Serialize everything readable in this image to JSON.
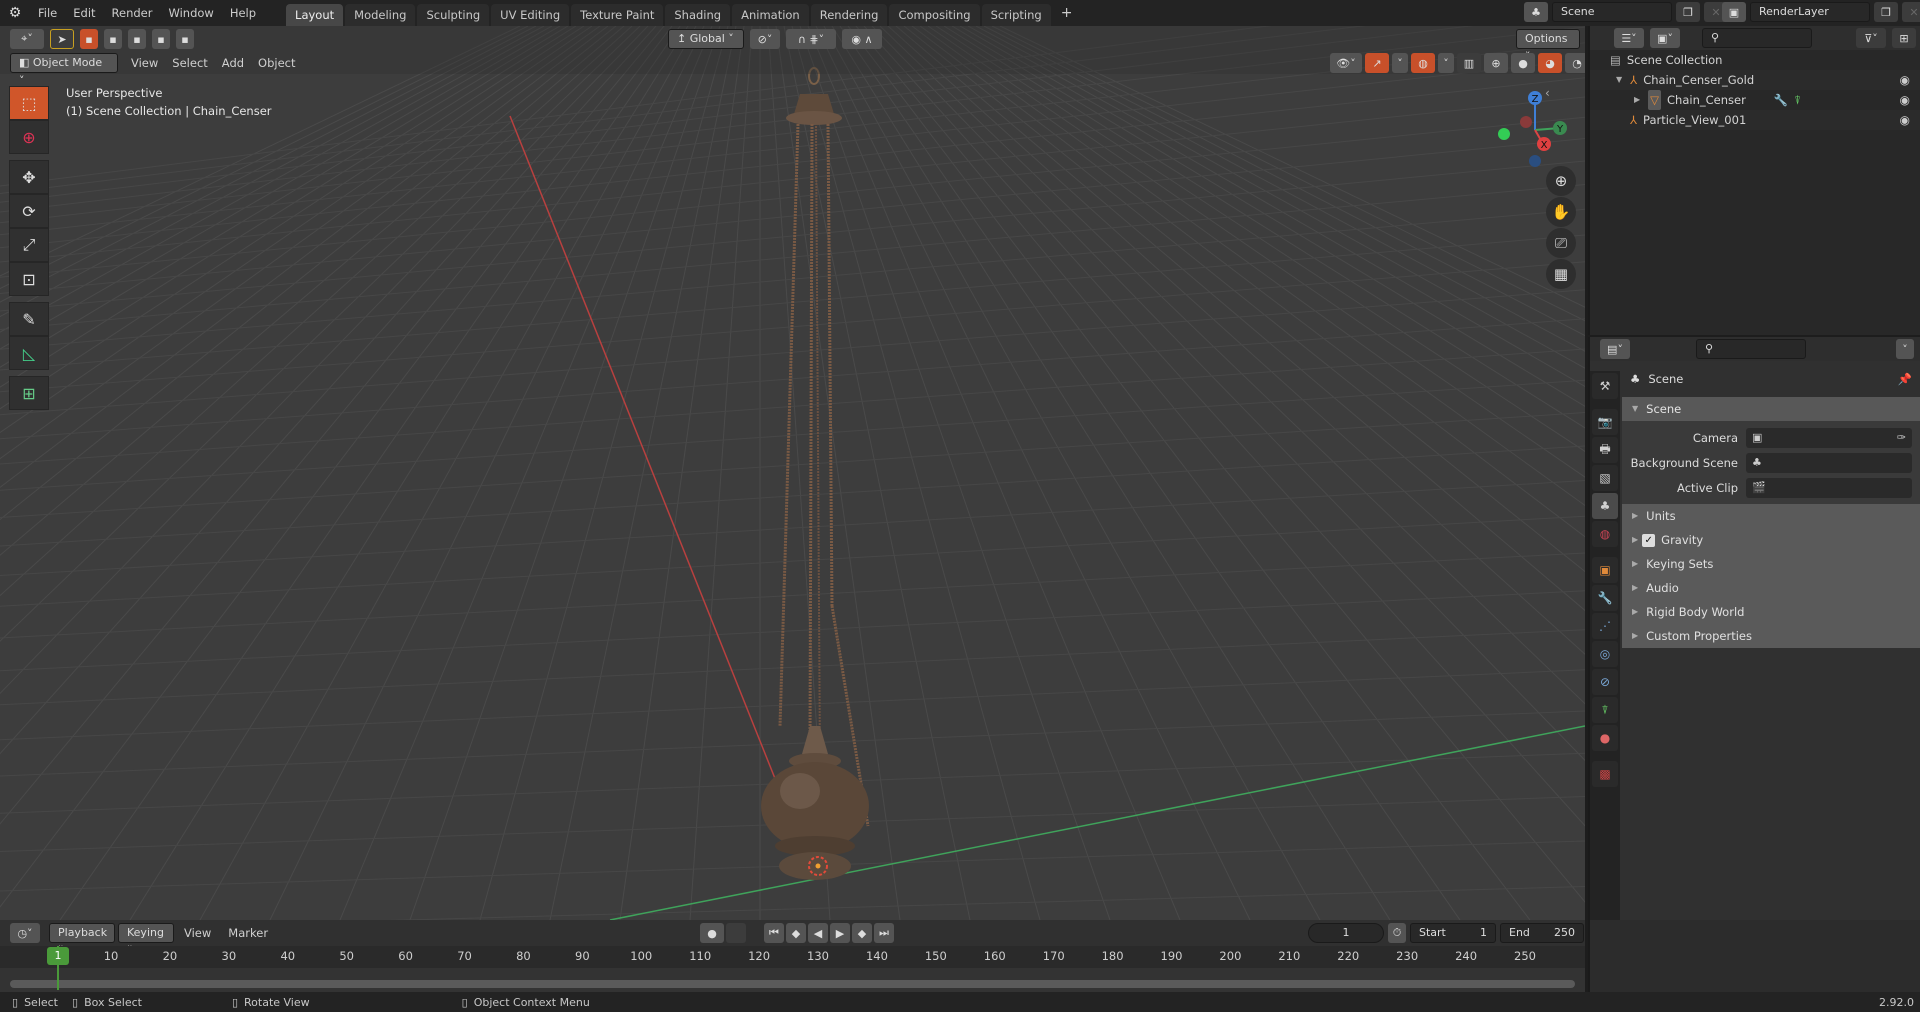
{
  "app": {
    "version": "2.92.0"
  },
  "topbar": {
    "menus": [
      "File",
      "Edit",
      "Render",
      "Window",
      "Help"
    ],
    "workspaces": [
      "Layout",
      "Modeling",
      "Sculpting",
      "UV Editing",
      "Texture Paint",
      "Shading",
      "Animation",
      "Rendering",
      "Compositing",
      "Scripting"
    ],
    "active_workspace": "Layout",
    "add_tab": "+",
    "scene": "Scene",
    "view_layer": "RenderLayer"
  },
  "tool_header": {
    "transform_orientation": "Global",
    "options_label": "Options"
  },
  "viewport": {
    "mode": "Object Mode",
    "menus": [
      "View",
      "Select",
      "Add",
      "Object"
    ],
    "overlay_title": "User Perspective",
    "overlay_subtitle": "(1) Scene Collection | Chain_Censer",
    "gizmo_axes": {
      "x": "X",
      "y": "Y",
      "z": "Z"
    },
    "colors": {
      "x_axis": "#b8403f",
      "y_axis": "#3fa35b",
      "active_tool": "#d0562a",
      "object": "#6b5240"
    }
  },
  "toolbar": {
    "tools": [
      {
        "name": "select-box",
        "glyph": "⬚"
      },
      {
        "name": "cursor",
        "glyph": "⊕"
      },
      {
        "name": "move",
        "glyph": "✥"
      },
      {
        "name": "rotate",
        "glyph": "⟳"
      },
      {
        "name": "scale",
        "glyph": "⤢"
      },
      {
        "name": "transform",
        "glyph": "⊡"
      },
      {
        "name": "annotate",
        "glyph": "✎"
      },
      {
        "name": "measure",
        "glyph": "📐"
      },
      {
        "name": "add-cube",
        "glyph": "⊞"
      }
    ]
  },
  "nav_gizmo": {
    "buttons": [
      {
        "name": "zoom",
        "glyph": "🔍"
      },
      {
        "name": "pan",
        "glyph": "✋"
      },
      {
        "name": "camera",
        "glyph": "🎥"
      },
      {
        "name": "perspective",
        "glyph": "▦"
      }
    ]
  },
  "outliner": {
    "root": "Scene Collection",
    "items": [
      {
        "label": "Chain_Censer_Gold",
        "depth": 1,
        "expanded": true
      },
      {
        "label": "Chain_Censer",
        "depth": 2,
        "expanded": false
      },
      {
        "label": "Particle_View_001",
        "depth": 1,
        "expanded": false
      }
    ]
  },
  "properties": {
    "context": "Scene",
    "panel_title": "Scene",
    "fields": [
      {
        "label": "Camera",
        "value": ""
      },
      {
        "label": "Background Scene",
        "value": ""
      },
      {
        "label": "Active Clip",
        "value": ""
      }
    ],
    "collapsed_panels": [
      "Units",
      "Gravity",
      "Keying Sets",
      "Audio",
      "Rigid Body World",
      "Custom Properties"
    ],
    "gravity_checked": true
  },
  "timeline": {
    "menus": [
      "Playback",
      "Keying",
      "View",
      "Marker"
    ],
    "current_frame": "1",
    "start_label": "Start",
    "start": "1",
    "end_label": "End",
    "end": "250",
    "ticks": [
      "1",
      "10",
      "20",
      "30",
      "40",
      "50",
      "60",
      "70",
      "80",
      "90",
      "100",
      "110",
      "120",
      "130",
      "140",
      "150",
      "160",
      "170",
      "180",
      "190",
      "200",
      "210",
      "220",
      "230",
      "240",
      "250"
    ]
  },
  "statusbar": {
    "hints": [
      "Select",
      "Box Select",
      "Rotate View",
      "Object Context Menu"
    ],
    "version": "2.92.0"
  }
}
